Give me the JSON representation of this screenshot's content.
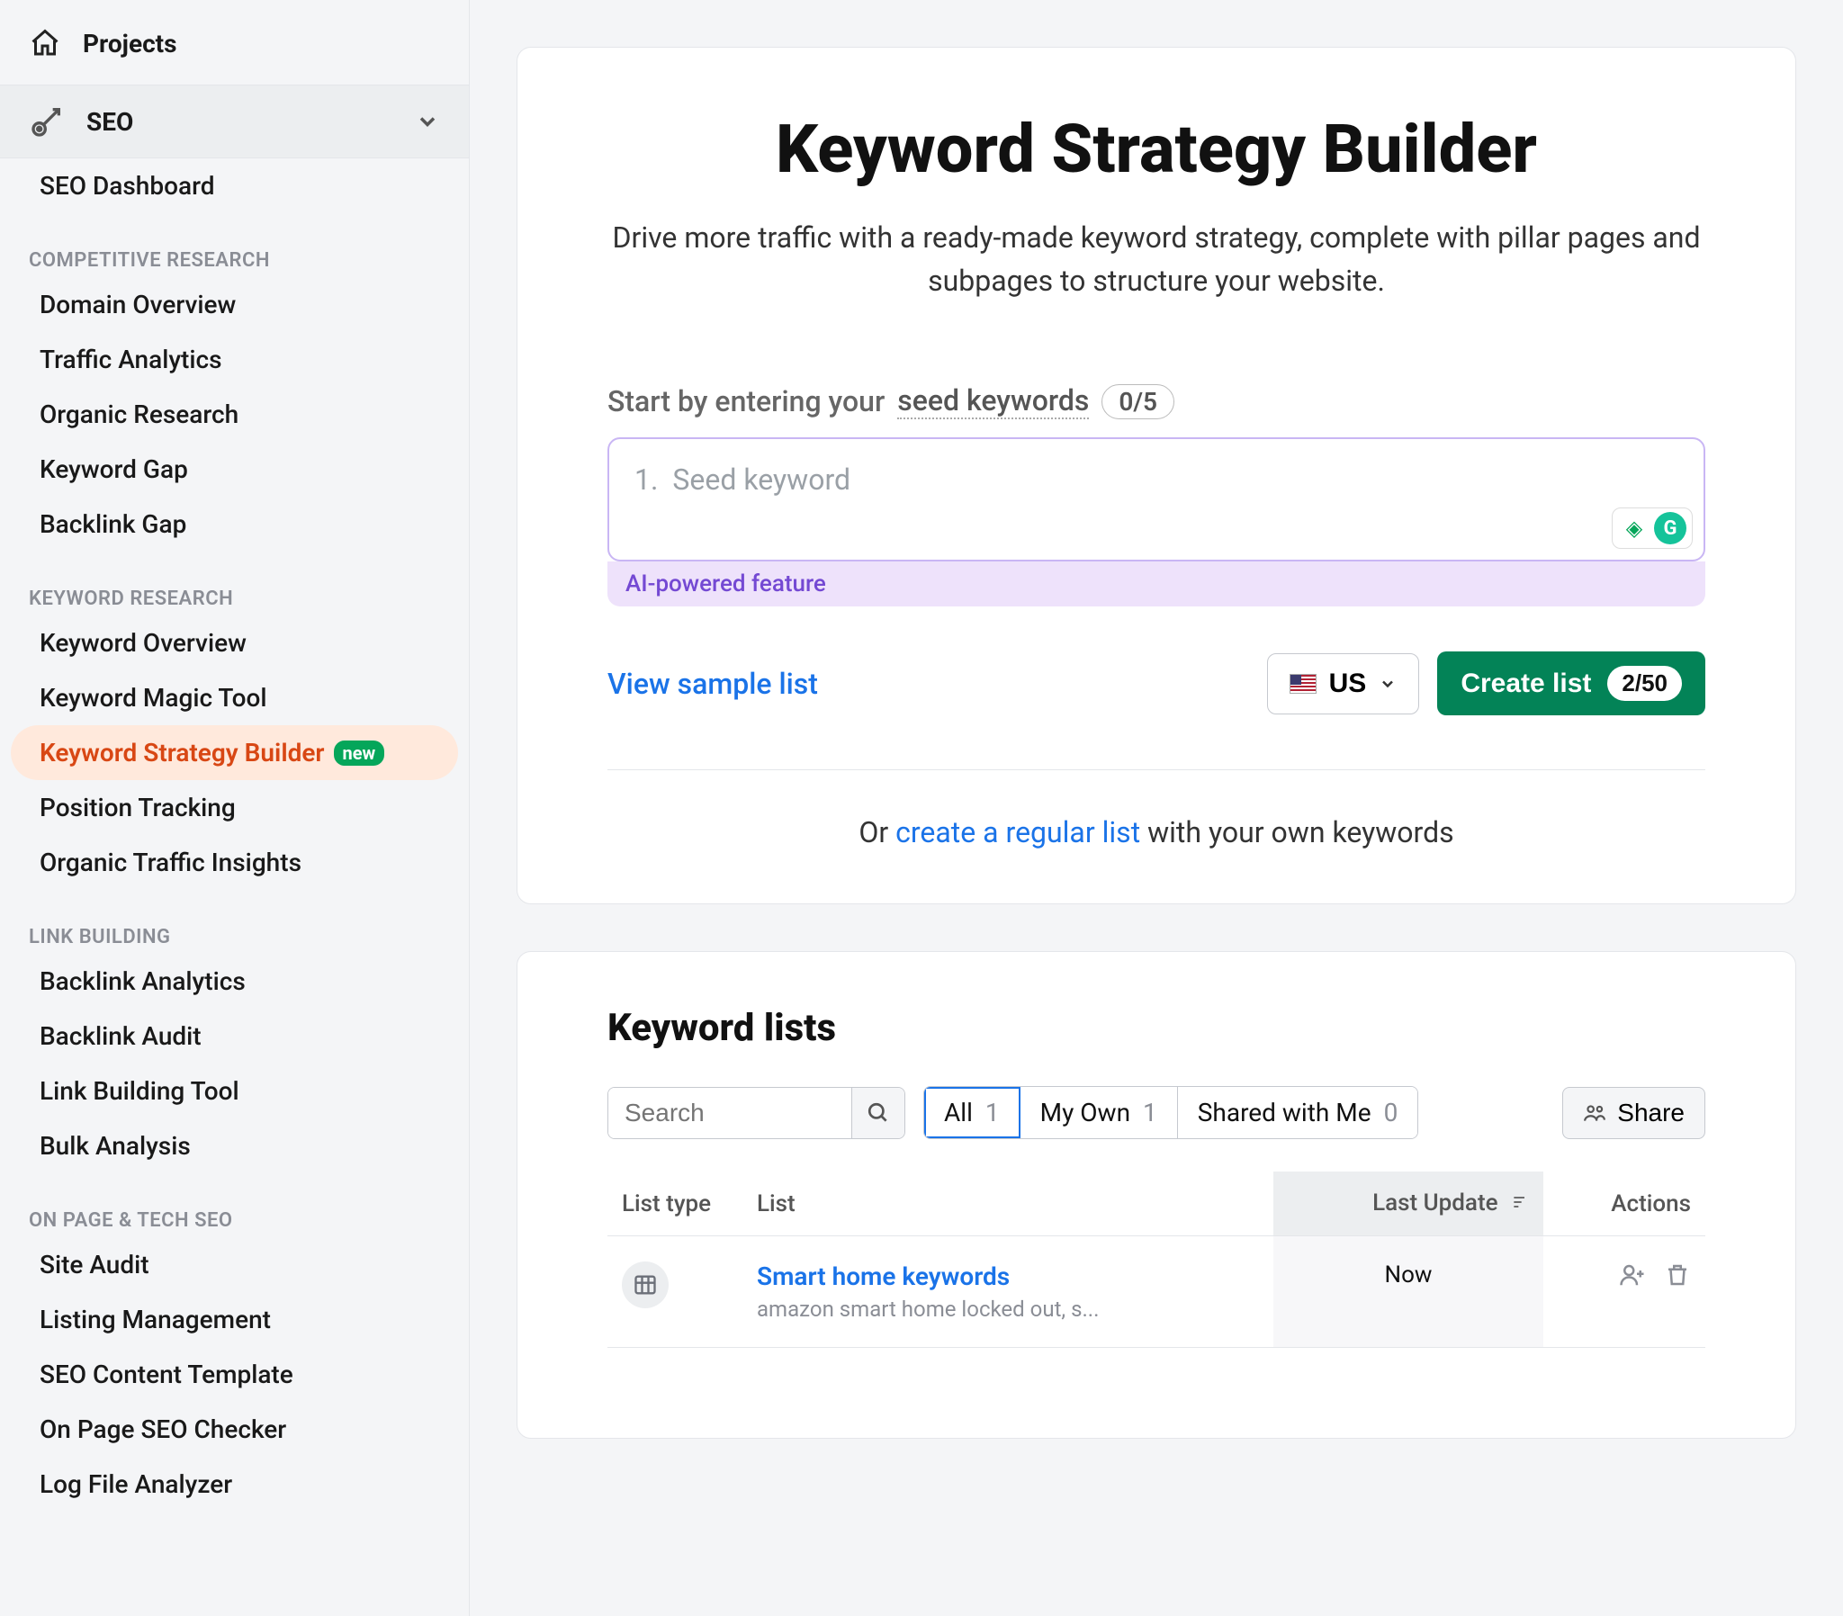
{
  "sidebar": {
    "projects_label": "Projects",
    "seo_label": "SEO",
    "dashboard": "SEO Dashboard",
    "groups": [
      {
        "heading": "COMPETITIVE RESEARCH",
        "items": [
          "Domain Overview",
          "Traffic Analytics",
          "Organic Research",
          "Keyword Gap",
          "Backlink Gap"
        ]
      },
      {
        "heading": "KEYWORD RESEARCH",
        "items": [
          "Keyword Overview",
          "Keyword Magic Tool",
          "Keyword Strategy Builder",
          "Position Tracking",
          "Organic Traffic Insights"
        ],
        "active_item": "Keyword Strategy Builder",
        "new_badge": "new"
      },
      {
        "heading": "LINK BUILDING",
        "items": [
          "Backlink Analytics",
          "Backlink Audit",
          "Link Building Tool",
          "Bulk Analysis"
        ]
      },
      {
        "heading": "ON PAGE & TECH SEO",
        "items": [
          "Site Audit",
          "Listing Management",
          "SEO Content Template",
          "On Page SEO Checker",
          "Log File Analyzer"
        ]
      }
    ]
  },
  "builder": {
    "title": "Keyword Strategy Builder",
    "subtitle": "Drive more traffic with a ready-made keyword strategy, complete with pillar pages and subpages to structure your website.",
    "prompt_prefix": "Start by entering your ",
    "seed_label": "seed keywords",
    "seed_count": "0/5",
    "seed_placeholder": "Seed keyword",
    "seed_index": "1.",
    "ai_note": "AI-powered feature",
    "view_sample": "View sample list",
    "country_code": "US",
    "create_label": "Create list",
    "create_count": "2/50",
    "or_prefix": "Or ",
    "or_link": "create a regular list",
    "or_suffix": " with your own keywords"
  },
  "lists": {
    "heading": "Keyword lists",
    "search_placeholder": "Search",
    "tabs": [
      {
        "label": "All",
        "count": "1",
        "active": true
      },
      {
        "label": "My Own",
        "count": "1",
        "active": false
      },
      {
        "label": "Shared with Me",
        "count": "0",
        "active": false
      }
    ],
    "share_label": "Share",
    "columns": {
      "list_type": "List type",
      "list": "List",
      "last_update": "Last Update",
      "actions": "Actions"
    },
    "rows": [
      {
        "title": "Smart home keywords",
        "subtitle": "amazon smart home locked out, s...",
        "last_update": "Now"
      }
    ]
  }
}
